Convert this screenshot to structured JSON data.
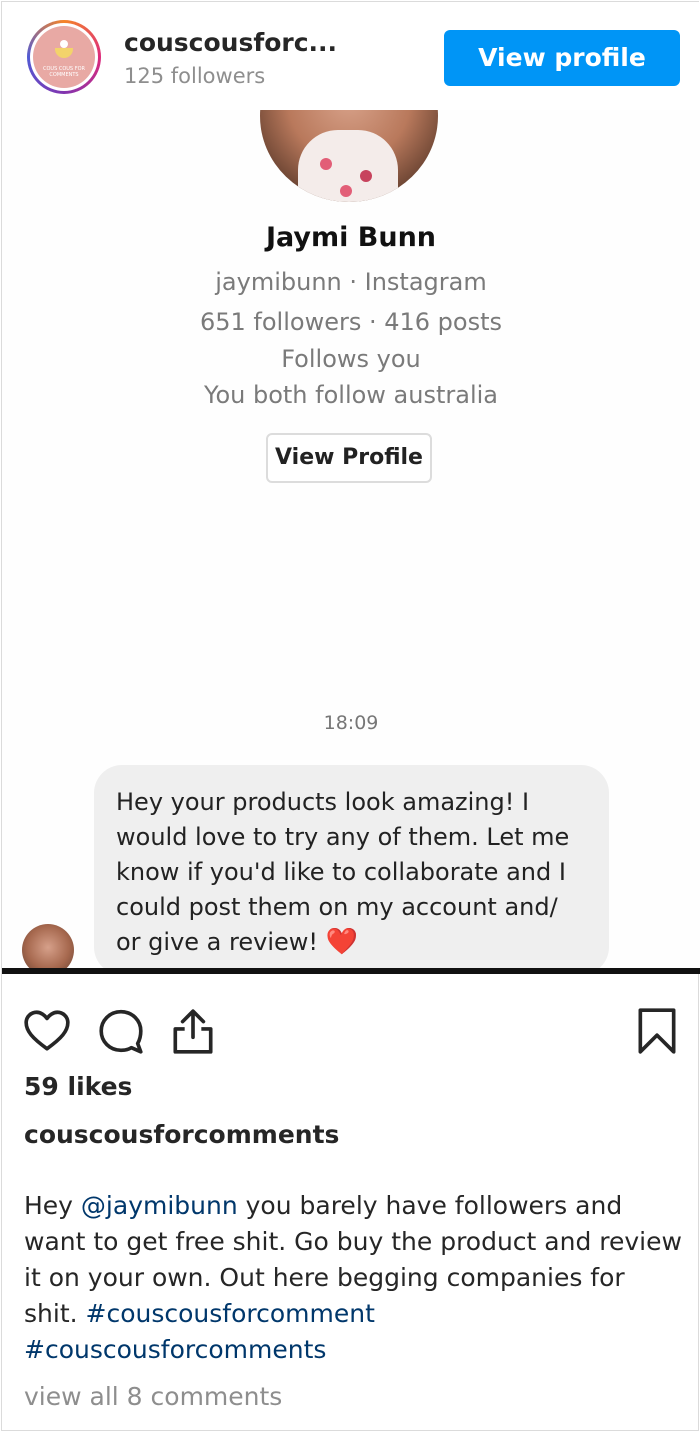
{
  "header": {
    "account_name": "couscousforc...",
    "followers": "125 followers",
    "view_profile_label": "View profile",
    "avatar_text": "COUS COUS FOR COMMENTS"
  },
  "screenshot": {
    "profile_name": "Jaymi Bunn",
    "handle_line": "jaymibunn · Instagram",
    "stats_line": "651 followers · 416 posts",
    "follows_you": "Follows you",
    "mutual": "You both follow australia",
    "view_profile_label": "View Profile",
    "time": "18:09",
    "message": "Hey your products look amazing! I would love to try any of them. Let me know if you'd like to collaborate and I could post them on my account and/ or give a review!",
    "message_emoji": "❤️"
  },
  "post": {
    "likes": "59 likes",
    "owner": "couscousforcomments",
    "caption_prefix": "Hey ",
    "caption_mention": "@jaymibunn",
    "caption_body": " you barely have followers and want to get free shit. Go buy the product and review it on your own. Out here begging companies for shit. ",
    "caption_tag1": "#couscousforcomment",
    "caption_tag2": "#couscousforcomments",
    "view_comments": "view all 8 comments"
  },
  "icons": [
    "heart-icon",
    "comment-icon",
    "share-icon",
    "bookmark-icon"
  ],
  "colors": {
    "accent": "#0095f6",
    "link": "#00376b",
    "muted": "#8e8e8e"
  }
}
